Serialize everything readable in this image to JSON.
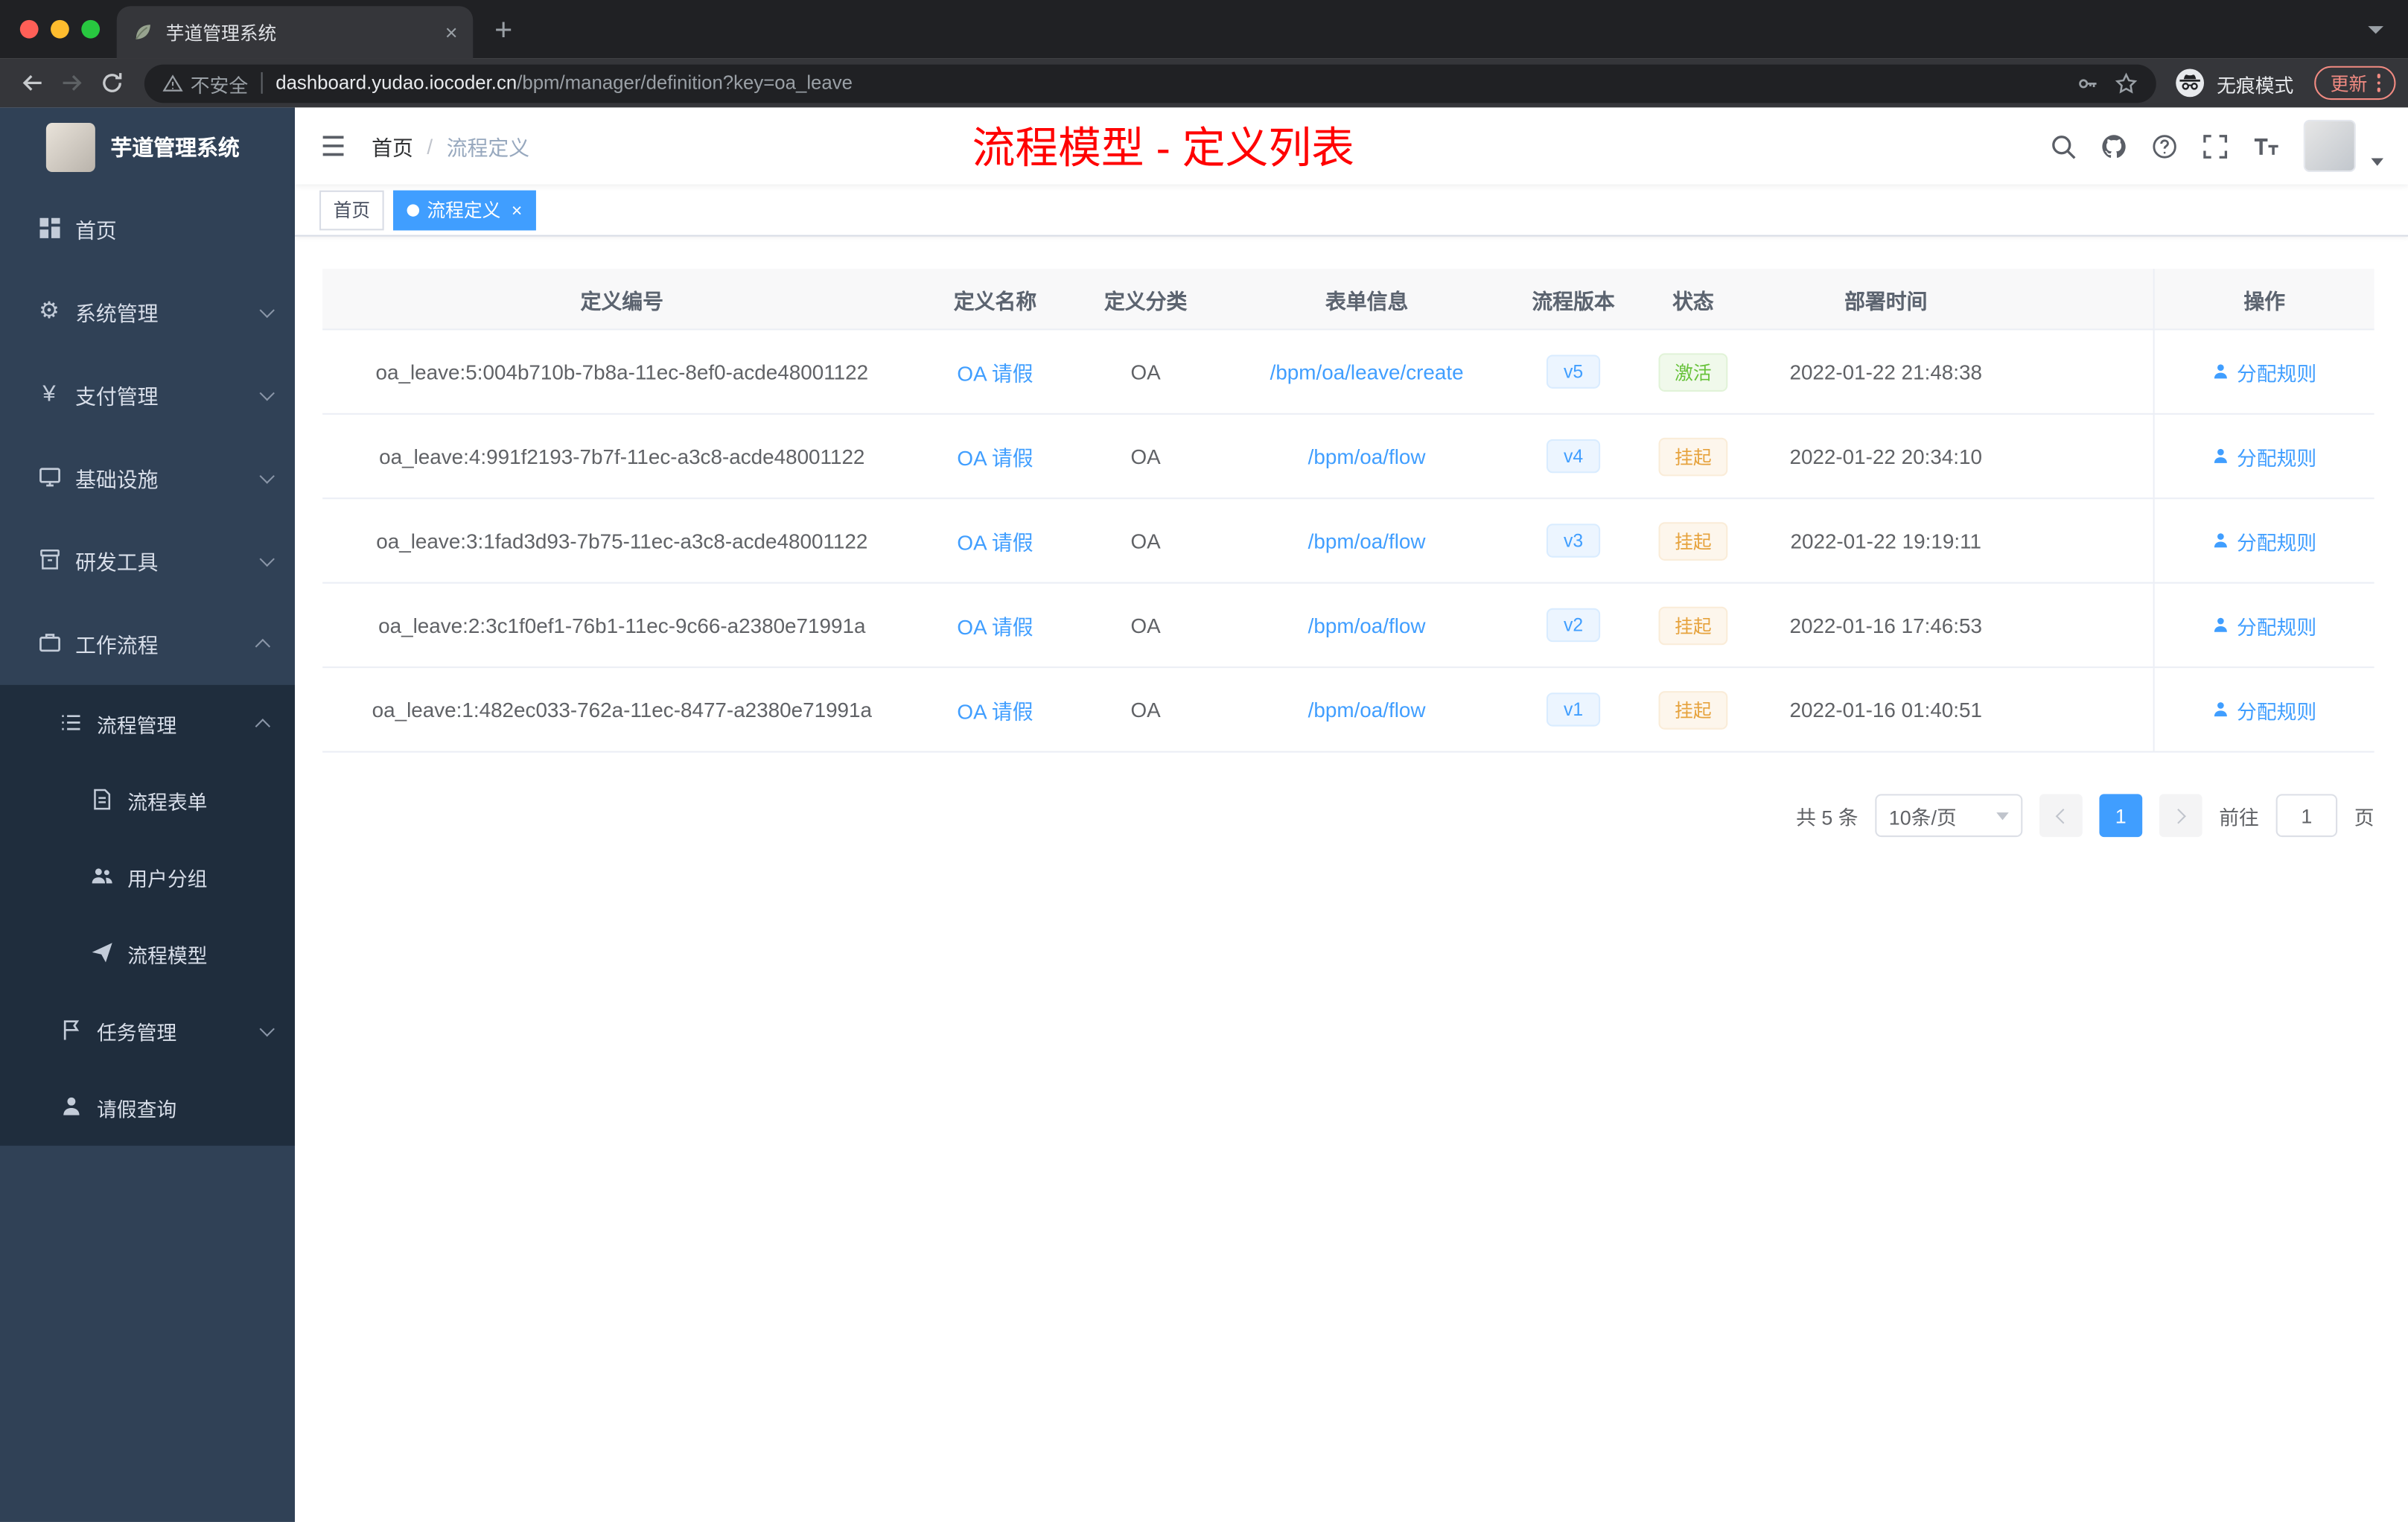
{
  "browser": {
    "tab": {
      "title": "芋道管理系统"
    },
    "toolbar": {
      "security_label": "不安全",
      "url_host": "dashboard.yudao.iocoder.cn",
      "url_path": "/bpm/manager/definition?key=oa_leave",
      "incognito_label": "无痕模式",
      "update_label": "更新"
    }
  },
  "sidebar": {
    "app_title": "芋道管理系统",
    "items": [
      {
        "label": "首页",
        "icon": "dashboard-icon"
      },
      {
        "label": "系统管理",
        "icon": "gear-icon"
      },
      {
        "label": "支付管理",
        "icon": "yen-icon"
      },
      {
        "label": "基础设施",
        "icon": "infrastructure-icon"
      },
      {
        "label": "研发工具",
        "icon": "toolbox-icon"
      },
      {
        "label": "工作流程",
        "icon": "briefcase-icon",
        "expanded": true
      }
    ],
    "workflow_children": [
      {
        "label": "流程管理",
        "icon": "list-icon",
        "expanded": true
      },
      {
        "label": "流程表单",
        "icon": "form-icon"
      },
      {
        "label": "用户分组",
        "icon": "users-icon"
      },
      {
        "label": "流程模型",
        "icon": "paper-plane-icon"
      },
      {
        "label": "任务管理",
        "icon": "flag-icon"
      },
      {
        "label": "请假查询",
        "icon": "person-icon"
      }
    ]
  },
  "header": {
    "breadcrumb_home": "首页",
    "breadcrumb_separator": "/",
    "breadcrumb_current": "流程定义",
    "annotation": "流程模型 - 定义列表",
    "icons": [
      "search-icon",
      "github-icon",
      "help-icon",
      "fullscreen-icon",
      "font-size-icon",
      "avatar"
    ]
  },
  "tags": {
    "home_label": "首页",
    "active_label": "流程定义"
  },
  "table": {
    "columns": [
      "定义编号",
      "定义名称",
      "定义分类",
      "表单信息",
      "流程版本",
      "状态",
      "部署时间",
      "操作"
    ],
    "rows": [
      {
        "id": "oa_leave:5:004b710b-7b8a-11ec-8ef0-acde48001122",
        "name": "OA 请假",
        "category": "OA",
        "form": "/bpm/oa/leave/create",
        "version": "v5",
        "status": "激活",
        "status_type": "success",
        "deploy_time": "2022-01-22 21:48:38",
        "action": "分配规则"
      },
      {
        "id": "oa_leave:4:991f2193-7b7f-11ec-a3c8-acde48001122",
        "name": "OA 请假",
        "category": "OA",
        "form": "/bpm/oa/flow",
        "version": "v4",
        "status": "挂起",
        "status_type": "warning",
        "deploy_time": "2022-01-22 20:34:10",
        "action": "分配规则"
      },
      {
        "id": "oa_leave:3:1fad3d93-7b75-11ec-a3c8-acde48001122",
        "name": "OA 请假",
        "category": "OA",
        "form": "/bpm/oa/flow",
        "version": "v3",
        "status": "挂起",
        "status_type": "warning",
        "deploy_time": "2022-01-22 19:19:11",
        "action": "分配规则"
      },
      {
        "id": "oa_leave:2:3c1f0ef1-76b1-11ec-9c66-a2380e71991a",
        "name": "OA 请假",
        "category": "OA",
        "form": "/bpm/oa/flow",
        "version": "v2",
        "status": "挂起",
        "status_type": "warning",
        "deploy_time": "2022-01-16 17:46:53",
        "action": "分配规则"
      },
      {
        "id": "oa_leave:1:482ec033-762a-11ec-8477-a2380e71991a",
        "name": "OA 请假",
        "category": "OA",
        "form": "/bpm/oa/flow",
        "version": "v1",
        "status": "挂起",
        "status_type": "warning",
        "deploy_time": "2022-01-16 01:40:51",
        "action": "分配规则"
      }
    ]
  },
  "pagination": {
    "total": "共 5 条",
    "page_size": "10条/页",
    "current": "1",
    "goto": "前往",
    "goto_value": "1",
    "unit": "页"
  },
  "colors": {
    "accent": "#409eff",
    "success": "#67c23a",
    "warning": "#e6a23c",
    "annotation": "#ff0000",
    "sidebar_bg": "#304156",
    "submenu_bg": "#1f2d3d"
  }
}
